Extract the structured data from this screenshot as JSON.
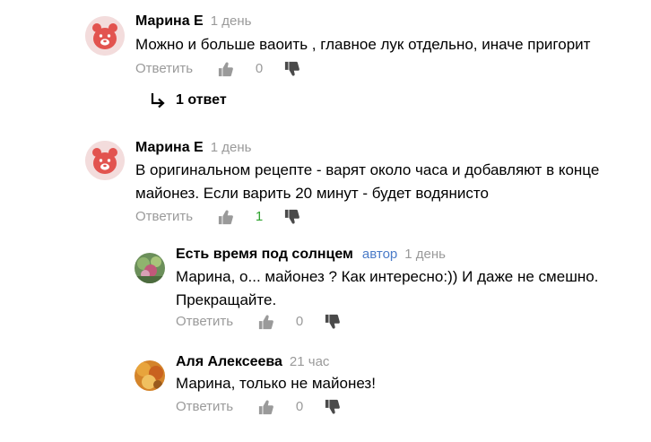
{
  "labels": {
    "reply": "Ответить"
  },
  "icons": {
    "like": "thumb-up-icon",
    "dislike": "thumb-down-icon",
    "replies": "reply-arrow-icon"
  },
  "colors": {
    "positive": "#2ea32e",
    "author_badge": "#4a7bc8",
    "muted": "#9a9a9a"
  },
  "comments": [
    {
      "author": "Марина Е",
      "time": "1 день",
      "text": "Можно и больше ваоить , главное лук отдельно, иначе пригорит",
      "votes": "0",
      "avatar": "bear-avatar"
    },
    {
      "author": "Марина Е",
      "time": "1 день",
      "text_lines": [
        "В оригинальном рецепте - варят около часа и добавляют в конце",
        "майонез. Если варить 20 минут - будет водянисто"
      ],
      "votes": "1",
      "avatar": "bear-avatar"
    }
  ],
  "replies_toggle": {
    "label": "1 ответ"
  },
  "replies": [
    {
      "author": "Есть время под солнцем",
      "badge": "автор",
      "time": "1 день",
      "text_lines": [
        "Марина, о... майонез ? Как интересно:)) И даже не смешно.",
        "Прекращайте."
      ],
      "votes": "0",
      "avatar": "photo-avatar"
    },
    {
      "author": "Аля Алексеева",
      "time": "21 час",
      "text": "Марина, только не майонез!",
      "votes": "0",
      "avatar": "photo-avatar"
    }
  ]
}
